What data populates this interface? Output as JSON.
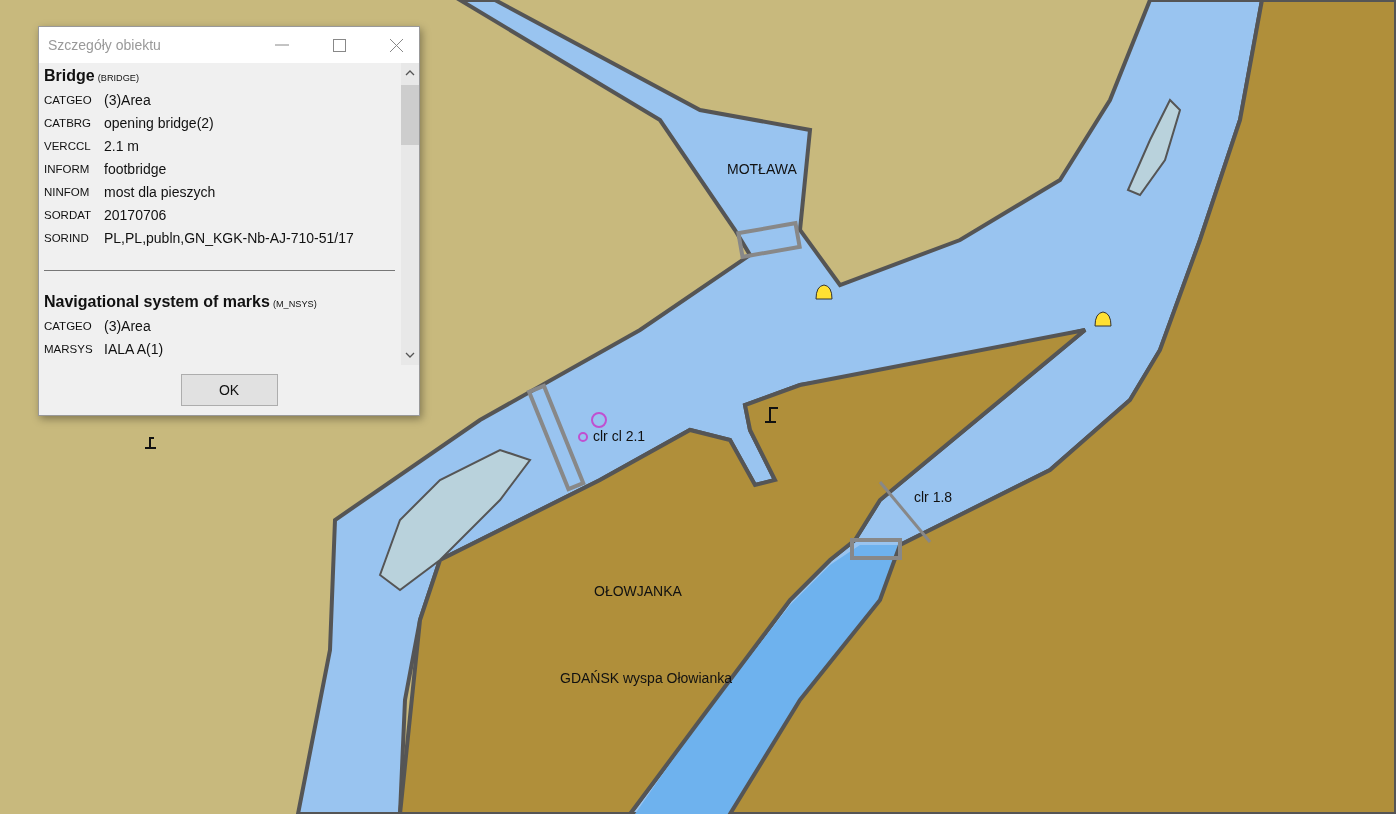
{
  "window": {
    "title": "Szczegóły obiektu"
  },
  "objects": [
    {
      "name": "Bridge",
      "code": "(BRIDGE)",
      "attributes": [
        {
          "key": "CATGEO",
          "value": "(3)Area"
        },
        {
          "key": "CATBRG",
          "value": "opening bridge(2)"
        },
        {
          "key": "VERCCL",
          "value": "2.1 m"
        },
        {
          "key": "INFORM",
          "value": "footbridge"
        },
        {
          "key": "NINFOM",
          "value": "most dla pieszych"
        },
        {
          "key": "SORDAT",
          "value": "20170706"
        },
        {
          "key": "SORIND",
          "value": "PL,PL,publn,GN_KGK-Nb-AJ-710-51/17"
        }
      ]
    },
    {
      "name": "Navigational system of marks",
      "code": "(M_NSYS)",
      "attributes": [
        {
          "key": "CATGEO",
          "value": "(3)Area"
        },
        {
          "key": "MARSYS",
          "value": "IALA A(1)"
        }
      ]
    }
  ],
  "buttons": [
    "OK"
  ],
  "map": {
    "labels": [
      "MOTŁAWA",
      "clr cl  2.1",
      "clr  1.8",
      "OŁOWJANKA",
      "GDAŃSK wyspa Ołowianka"
    ]
  }
}
